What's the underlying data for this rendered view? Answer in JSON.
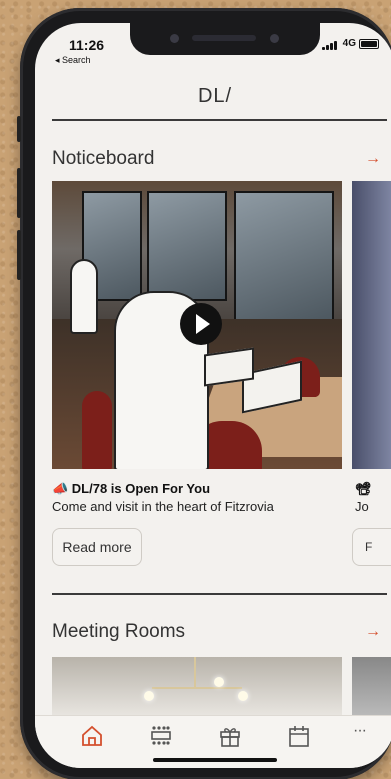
{
  "status_bar": {
    "time": "11:26",
    "back_label": "◂ Search",
    "network": "4G"
  },
  "header": {
    "logo": "DL/"
  },
  "noticeboard": {
    "title": "Noticeboard",
    "arrow": "→",
    "cards": [
      {
        "title": "📣 DL/78 is Open For You",
        "subtitle": "Come and visit in the heart of Fitzrovia",
        "button": "Read more"
      },
      {
        "title": "📽",
        "subtitle": "Jo",
        "button": "F"
      }
    ]
  },
  "meeting_rooms": {
    "title": "Meeting Rooms",
    "arrow": "→"
  },
  "tabbar": {
    "active_color": "#d4502e",
    "inactive_color": "#555555",
    "items": [
      "home-icon",
      "meeting-room-icon",
      "gift-icon",
      "calendar-icon",
      "more-icon"
    ],
    "more_glyph": "···"
  }
}
